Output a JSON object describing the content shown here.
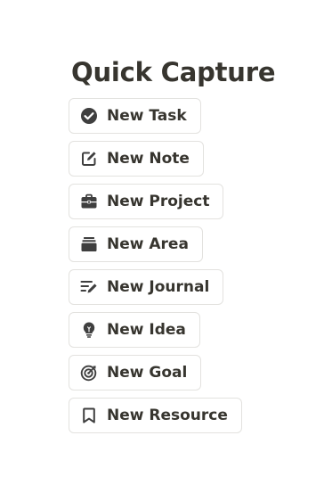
{
  "header": {
    "title": "Quick Capture"
  },
  "buttons": [
    {
      "label": "New Task",
      "icon": "check-circle-icon"
    },
    {
      "label": "New Note",
      "icon": "edit-note-icon"
    },
    {
      "label": "New Project",
      "icon": "briefcase-icon"
    },
    {
      "label": "New Area",
      "icon": "stack-icon"
    },
    {
      "label": "New Journal",
      "icon": "journal-lines-pen-icon"
    },
    {
      "label": "New Idea",
      "icon": "lightbulb-icon"
    },
    {
      "label": "New Goal",
      "icon": "target-icon"
    },
    {
      "label": "New Resource",
      "icon": "bookmark-icon"
    }
  ],
  "colors": {
    "text": "#37352f",
    "icon": "#3f3f3f",
    "border": "#e3e2df",
    "background": "#ffffff"
  }
}
